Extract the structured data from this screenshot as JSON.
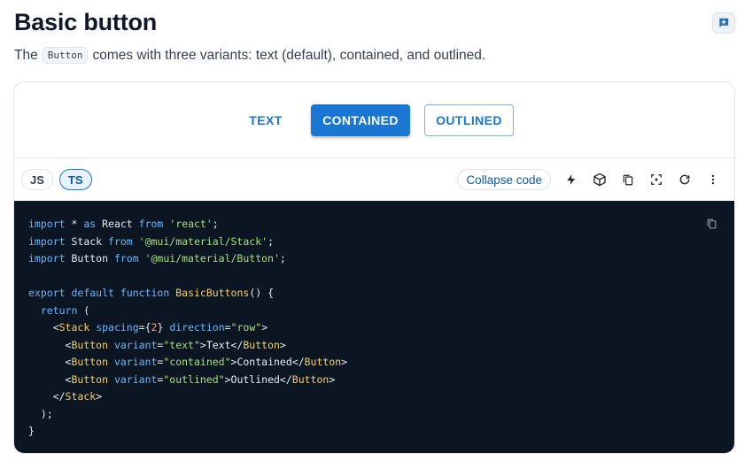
{
  "page": {
    "title": "Basic button",
    "desc_before": "The",
    "desc_code": "Button",
    "desc_after": "comes with three variants: text (default), contained, and outlined."
  },
  "demo": {
    "buttons": [
      "TEXT",
      "CONTAINED",
      "OUTLINED"
    ]
  },
  "toolbar": {
    "tabs": [
      "JS",
      "TS"
    ],
    "active_tab": "TS",
    "collapse_label": "Collapse code",
    "icons": [
      "lightning-icon",
      "cube-icon",
      "copy-icon",
      "fullscreen-icon",
      "refresh-icon",
      "more-vert-icon"
    ]
  },
  "code": {
    "line1": {
      "a": "import",
      "b": " * ",
      "c": "as",
      "d": " React ",
      "e": "from",
      "f": " ",
      "g": "'react'",
      "h": ";"
    },
    "line2": {
      "a": "import",
      "b": " Stack ",
      "c": "from",
      "d": " ",
      "e": "'@mui/material/Stack'",
      "f": ";"
    },
    "line3": {
      "a": "import",
      "b": " Button ",
      "c": "from",
      "d": " ",
      "e": "'@mui/material/Button'",
      "f": ";"
    },
    "line5": {
      "a": "export",
      "b": " ",
      "c": "default",
      "d": " ",
      "e": "function",
      "f": " ",
      "g": "BasicButtons",
      "h": "() {"
    },
    "line6": {
      "a": "  ",
      "b": "return",
      "c": " ("
    },
    "line7": {
      "a": "    <",
      "b": "Stack",
      "c": " ",
      "d": "spacing",
      "e": "={",
      "f": "2",
      "g": "} ",
      "h": "direction",
      "i": "=",
      "j": "\"row\"",
      "k": ">"
    },
    "line8": {
      "a": "      <",
      "b": "Button",
      "c": " ",
      "d": "variant",
      "e": "=",
      "f": "\"text\"",
      "g": ">Text</",
      "h": "Button",
      "i": ">"
    },
    "line9": {
      "a": "      <",
      "b": "Button",
      "c": " ",
      "d": "variant",
      "e": "=",
      "f": "\"contained\"",
      "g": ">Contained</",
      "h": "Button",
      "i": ">"
    },
    "line10": {
      "a": "      <",
      "b": "Button",
      "c": " ",
      "d": "variant",
      "e": "=",
      "f": "\"outlined\"",
      "g": ">Outlined</",
      "h": "Button",
      "i": ">"
    },
    "line11": {
      "a": "    </",
      "b": "Stack",
      "c": ">"
    },
    "line12": {
      "a": "  );"
    },
    "line13": {
      "a": "}"
    }
  },
  "colors": {
    "primary": "#1976d2",
    "code_bg": "#0c1522"
  }
}
